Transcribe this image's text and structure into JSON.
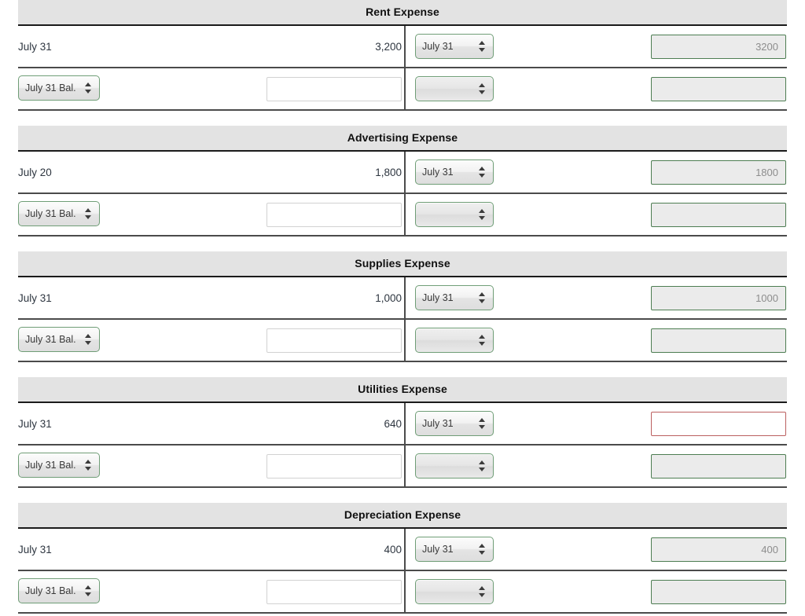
{
  "page": {
    "background": "#ffffff",
    "accent_border_green": "#4d7d52",
    "error_border_red": "#bb5f5f",
    "header_band": "#e3e3e3",
    "divider": "#4b4b4b"
  },
  "common": {
    "balance_select_label": "July 31 Bal.",
    "empty_select_label": "",
    "blank_input_value": "",
    "blank_input_placeholder": ""
  },
  "accounts": [
    {
      "title": "Rent Expense",
      "entry_row": {
        "posted_date": "July 31",
        "posted_amount": "3,200",
        "date_select_value": "July 31",
        "amount_input_value": "3200",
        "amount_input_state": "readonly"
      },
      "balance_row": {
        "balance_select_value": "July 31 Bal.",
        "balance_input_value": "",
        "right_select_value": "",
        "right_input_value": "",
        "right_input_state": "readonly"
      }
    },
    {
      "title": "Advertising Expense",
      "entry_row": {
        "posted_date": "July 20",
        "posted_amount": "1,800",
        "date_select_value": "July 31",
        "amount_input_value": "1800",
        "amount_input_state": "readonly"
      },
      "balance_row": {
        "balance_select_value": "July 31 Bal.",
        "balance_input_value": "",
        "right_select_value": "",
        "right_input_value": "",
        "right_input_state": "readonly"
      }
    },
    {
      "title": "Supplies Expense",
      "entry_row": {
        "posted_date": "July 31",
        "posted_amount": "1,000",
        "date_select_value": "July 31",
        "amount_input_value": "1000",
        "amount_input_state": "readonly"
      },
      "balance_row": {
        "balance_select_value": "July 31 Bal.",
        "balance_input_value": "",
        "right_select_value": "",
        "right_input_value": "",
        "right_input_state": "readonly"
      }
    },
    {
      "title": "Utilities Expense",
      "entry_row": {
        "posted_date": "July 31",
        "posted_amount": "640",
        "date_select_value": "July 31",
        "amount_input_value": "",
        "amount_input_state": "error"
      },
      "balance_row": {
        "balance_select_value": "July 31 Bal.",
        "balance_input_value": "",
        "right_select_value": "",
        "right_input_value": "",
        "right_input_state": "readonly"
      }
    },
    {
      "title": "Depreciation Expense",
      "entry_row": {
        "posted_date": "July 31",
        "posted_amount": "400",
        "date_select_value": "July 31",
        "amount_input_value": "400",
        "amount_input_state": "readonly"
      },
      "balance_row": {
        "balance_select_value": "July 31 Bal.",
        "balance_input_value": "",
        "right_select_value": "",
        "right_input_value": "",
        "right_input_state": "readonly"
      }
    }
  ]
}
